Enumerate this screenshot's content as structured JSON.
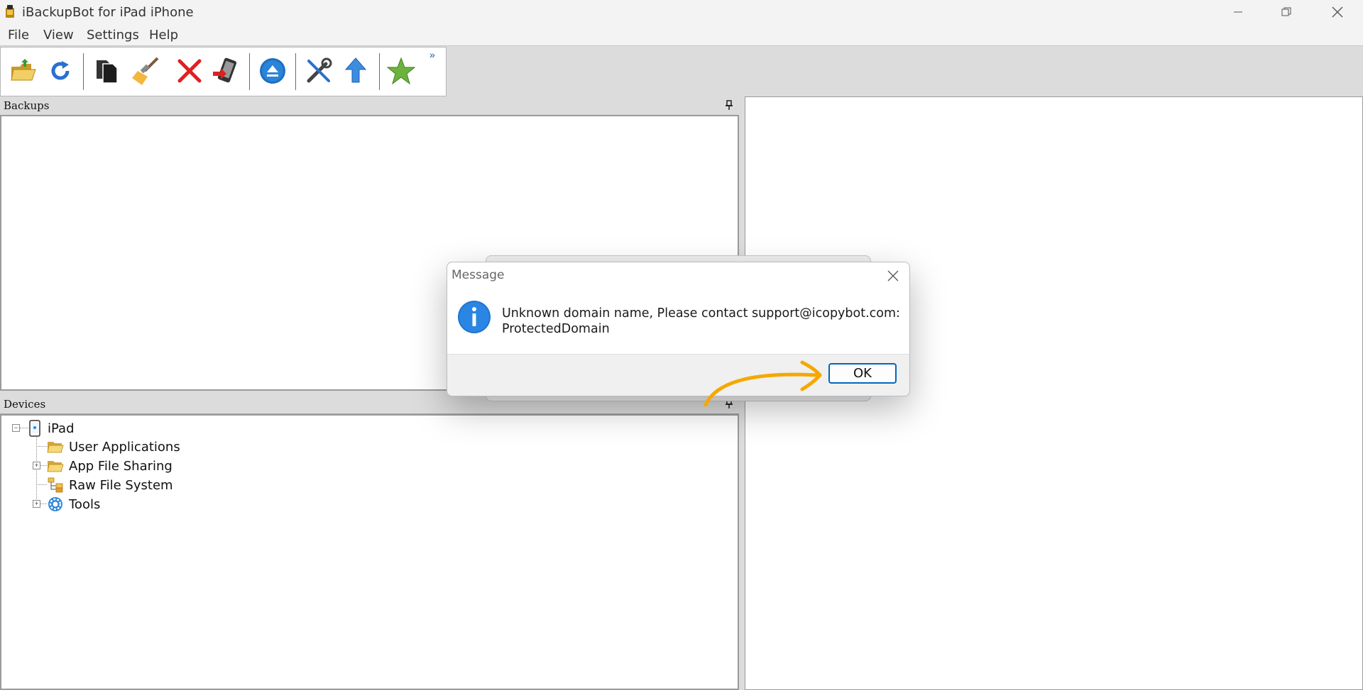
{
  "window": {
    "title": "iBackupBot for iPad iPhone",
    "controls": {
      "minimize": "minimize-icon",
      "maximize": "restore-icon",
      "close": "close-icon"
    }
  },
  "menu": {
    "items": [
      {
        "label": "File"
      },
      {
        "label": "View"
      },
      {
        "label": "Settings"
      },
      {
        "label": "Help"
      }
    ]
  },
  "toolbar": {
    "buttons": [
      {
        "icon": "open-folder-icon"
      },
      {
        "icon": "refresh-icon"
      },
      {
        "icon": "copy-icon"
      },
      {
        "icon": "broom-clean-icon"
      },
      {
        "icon": "delete-icon"
      },
      {
        "icon": "restore-to-device-icon"
      },
      {
        "icon": "eject-icon"
      },
      {
        "icon": "tools-icon"
      },
      {
        "icon": "upgrade-arrow-icon"
      },
      {
        "icon": "favorite-star-icon"
      }
    ],
    "overflow": "»"
  },
  "panels": {
    "backups": {
      "title": "Backups"
    },
    "devices": {
      "title": "Devices"
    }
  },
  "tree": {
    "root": {
      "label": "iPad",
      "icon": "ipad-device-icon"
    },
    "children": [
      {
        "label": "User Applications",
        "icon": "folder-icon"
      },
      {
        "label": "App File Sharing",
        "icon": "folder-icon"
      },
      {
        "label": "Raw File System",
        "icon": "file-tree-icon"
      },
      {
        "label": "Tools",
        "icon": "gear-icon"
      }
    ]
  },
  "dialog": {
    "title": "Message",
    "message_line1": "Unknown domain name, Please contact support@icopybot.com:",
    "message_line2": "ProtectedDomain",
    "ok_label": "OK",
    "icon": "info-icon"
  },
  "colors": {
    "accent": "#0067c0",
    "annotation_arrow": "#f5a800",
    "info_icon": "#1e74d2"
  }
}
